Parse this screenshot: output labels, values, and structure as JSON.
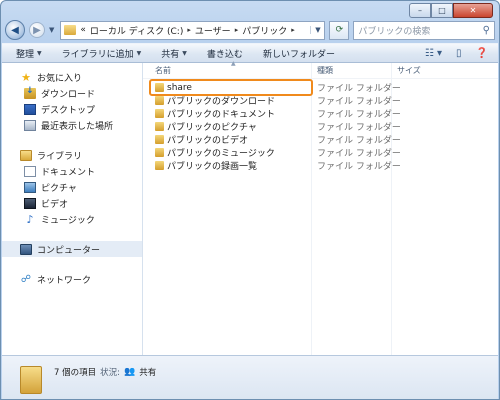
{
  "address": {
    "segments": [
      "«",
      "ローカル ディスク (C:)",
      "ユーザー",
      "パブリック"
    ],
    "search_placeholder": "パブリックの検索"
  },
  "toolbar": {
    "organize": "整理",
    "add_to_library": "ライブラリに追加",
    "share": "共有",
    "burn": "書き込む",
    "new_folder": "新しいフォルダー"
  },
  "nav": {
    "favorites": {
      "title": "お気に入り",
      "items": [
        "ダウンロード",
        "デスクトップ",
        "最近表示した場所"
      ]
    },
    "libraries": {
      "title": "ライブラリ",
      "items": [
        "ドキュメント",
        "ピクチャ",
        "ビデオ",
        "ミュージック"
      ]
    },
    "computer": "コンピューター",
    "network": "ネットワーク"
  },
  "columns": {
    "name": "名前",
    "type": "種類",
    "size": "サイズ"
  },
  "files": [
    {
      "name": "share",
      "type": "ファイル フォルダー",
      "selected": true
    },
    {
      "name": "パブリックのダウンロード",
      "type": "ファイル フォルダー"
    },
    {
      "name": "パブリックのドキュメント",
      "type": "ファイル フォルダー"
    },
    {
      "name": "パブリックのピクチャ",
      "type": "ファイル フォルダー"
    },
    {
      "name": "パブリックのビデオ",
      "type": "ファイル フォルダー"
    },
    {
      "name": "パブリックのミュージック",
      "type": "ファイル フォルダー"
    },
    {
      "name": "パブリックの録画一覧",
      "type": "ファイル フォルダー"
    }
  ],
  "details": {
    "item_count": "7 個の項目",
    "status_label": "状況:",
    "status_value": "共有"
  },
  "colors": {
    "selection_border": "#f08a1c",
    "window_frame": "#b9d1ee"
  }
}
